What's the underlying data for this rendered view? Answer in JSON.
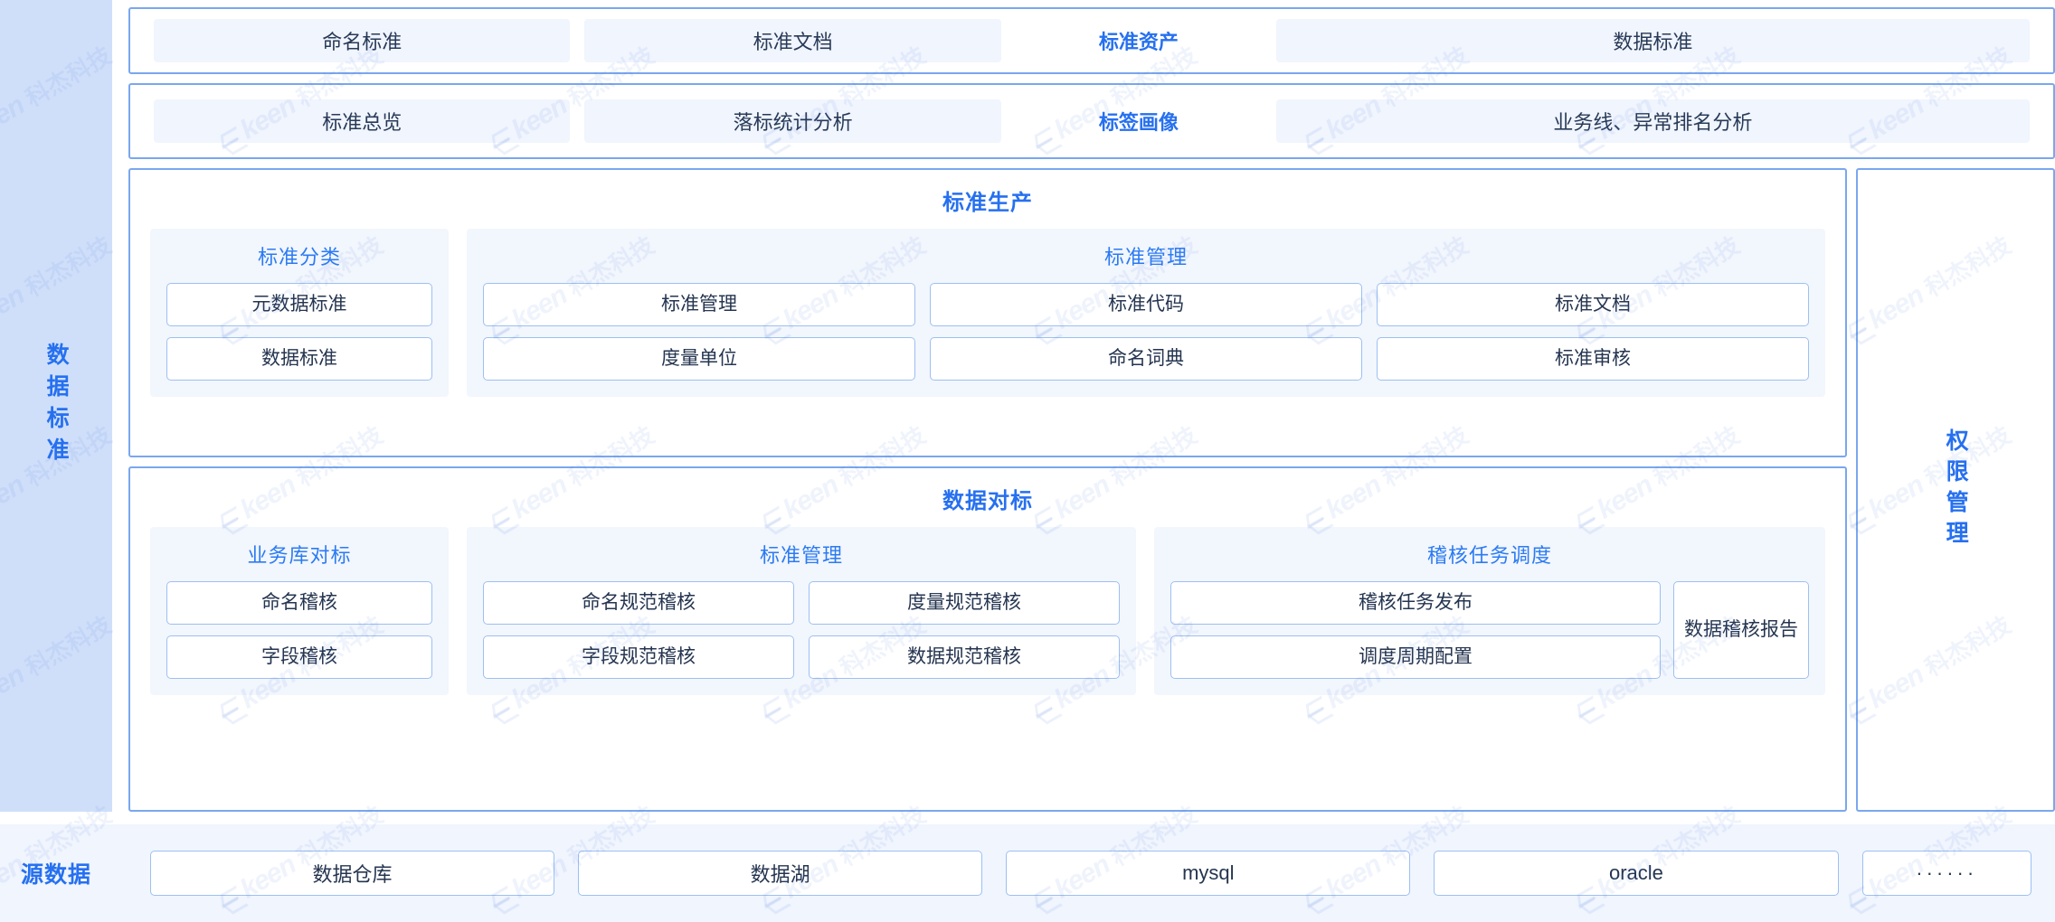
{
  "left_rail": {
    "label": "数据标准"
  },
  "right_rail": {
    "label": "权限管理"
  },
  "top_tabs": [
    {
      "label": "命名标准",
      "active": false
    },
    {
      "label": "标准文档",
      "active": false
    },
    {
      "label": "标准资产",
      "active": true
    },
    {
      "label": "数据标准",
      "active": false
    }
  ],
  "second_tabs": [
    {
      "label": "标准总览",
      "active": false
    },
    {
      "label": "落标统计分析",
      "active": false
    },
    {
      "label": "标签画像",
      "active": true
    },
    {
      "label": "业务线、异常排名分析",
      "active": false
    }
  ],
  "production": {
    "title": "标准生产",
    "classification": {
      "title": "标准分类",
      "items": [
        "元数据标准",
        "数据标准"
      ]
    },
    "standard_management": {
      "title": "标准管理",
      "items": [
        "标准管理",
        "标准代码",
        "标准文档",
        "度量单位",
        "命名词典",
        "标准审核"
      ]
    }
  },
  "benchmarking": {
    "title": "数据对标",
    "business_library": {
      "title": "业务库对标",
      "items": [
        "命名稽核",
        "字段稽核"
      ]
    },
    "standard_management": {
      "title": "标准管理",
      "items": [
        "命名规范稽核",
        "度量规范稽核",
        "字段规范稽核",
        "数据规范稽核"
      ]
    },
    "audit_schedule": {
      "title": "稽核任务调度",
      "items": [
        "稽核任务发布",
        "调度周期配置"
      ],
      "report": "数据稽核报告"
    }
  },
  "source_data": {
    "label": "源数据",
    "items": [
      "数据仓库",
      "数据湖",
      "mysql",
      "oracle",
      "······"
    ]
  },
  "watermark": {
    "text": "keen",
    "text_cn": "科杰科技"
  },
  "colors": {
    "accent": "#2670f0",
    "accent_soft": "#2b7bf3",
    "rail_bg": "#cfdffa",
    "panel_border": "#7aa7ee",
    "cell_border": "#9dc0f2",
    "group_bg": "#f2f6fd",
    "tab_bg": "#f0f5fe",
    "text": "#253550"
  }
}
